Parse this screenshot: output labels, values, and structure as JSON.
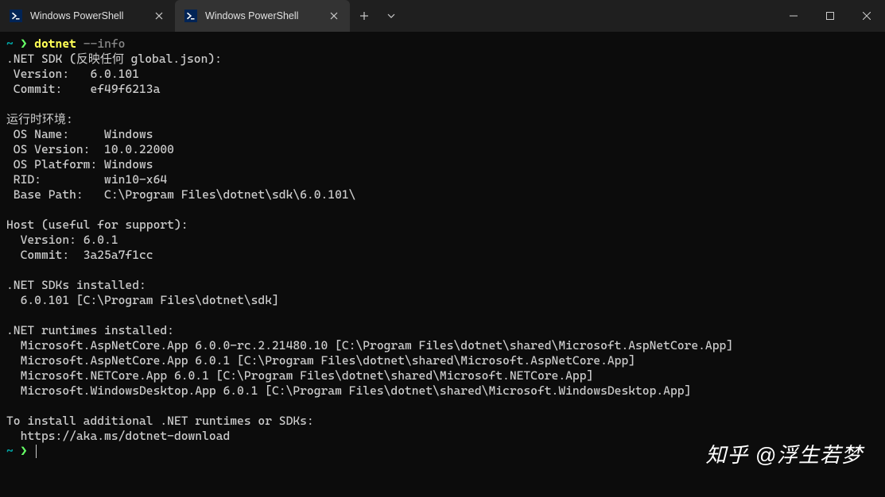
{
  "tabs": [
    {
      "title": "Windows PowerShell",
      "active": false
    },
    {
      "title": "Windows PowerShell",
      "active": true
    }
  ],
  "prompt": {
    "tilde": "~",
    "arrow": "❯",
    "command": "dotnet",
    "arg": "--info"
  },
  "output": {
    "sdk_header": ".NET SDK (反映任何 global.json):",
    "sdk_version_label": " Version:   ",
    "sdk_version": "6.0.101",
    "sdk_commit_label": " Commit:    ",
    "sdk_commit": "ef49f6213a",
    "runtime_env_header": "运行时环境:",
    "os_name_label": " OS Name:     ",
    "os_name": "Windows",
    "os_version_label": " OS Version:  ",
    "os_version": "10.0.22000",
    "os_platform_label": " OS Platform: ",
    "os_platform": "Windows",
    "rid_label": " RID:         ",
    "rid": "win10-x64",
    "base_path_label": " Base Path:   ",
    "base_path": "C:\\Program Files\\dotnet\\sdk\\6.0.101\\",
    "host_header": "Host (useful for support):",
    "host_version_label": "  Version: ",
    "host_version": "6.0.1",
    "host_commit_label": "  Commit:  ",
    "host_commit": "3a25a7f1cc",
    "sdks_installed_header": ".NET SDKs installed:",
    "sdk_installed_1": "  6.0.101 [C:\\Program Files\\dotnet\\sdk]",
    "runtimes_installed_header": ".NET runtimes installed:",
    "runtime_1": "  Microsoft.AspNetCore.App 6.0.0-rc.2.21480.10 [C:\\Program Files\\dotnet\\shared\\Microsoft.AspNetCore.App]",
    "runtime_2": "  Microsoft.AspNetCore.App 6.0.1 [C:\\Program Files\\dotnet\\shared\\Microsoft.AspNetCore.App]",
    "runtime_3": "  Microsoft.NETCore.App 6.0.1 [C:\\Program Files\\dotnet\\shared\\Microsoft.NETCore.App]",
    "runtime_4": "  Microsoft.WindowsDesktop.App 6.0.1 [C:\\Program Files\\dotnet\\shared\\Microsoft.WindowsDesktop.App]",
    "install_more_header": "To install additional .NET runtimes or SDKs:",
    "install_more_url": "  https://aka.ms/dotnet-download"
  },
  "watermark": "知乎 @浮生若梦"
}
